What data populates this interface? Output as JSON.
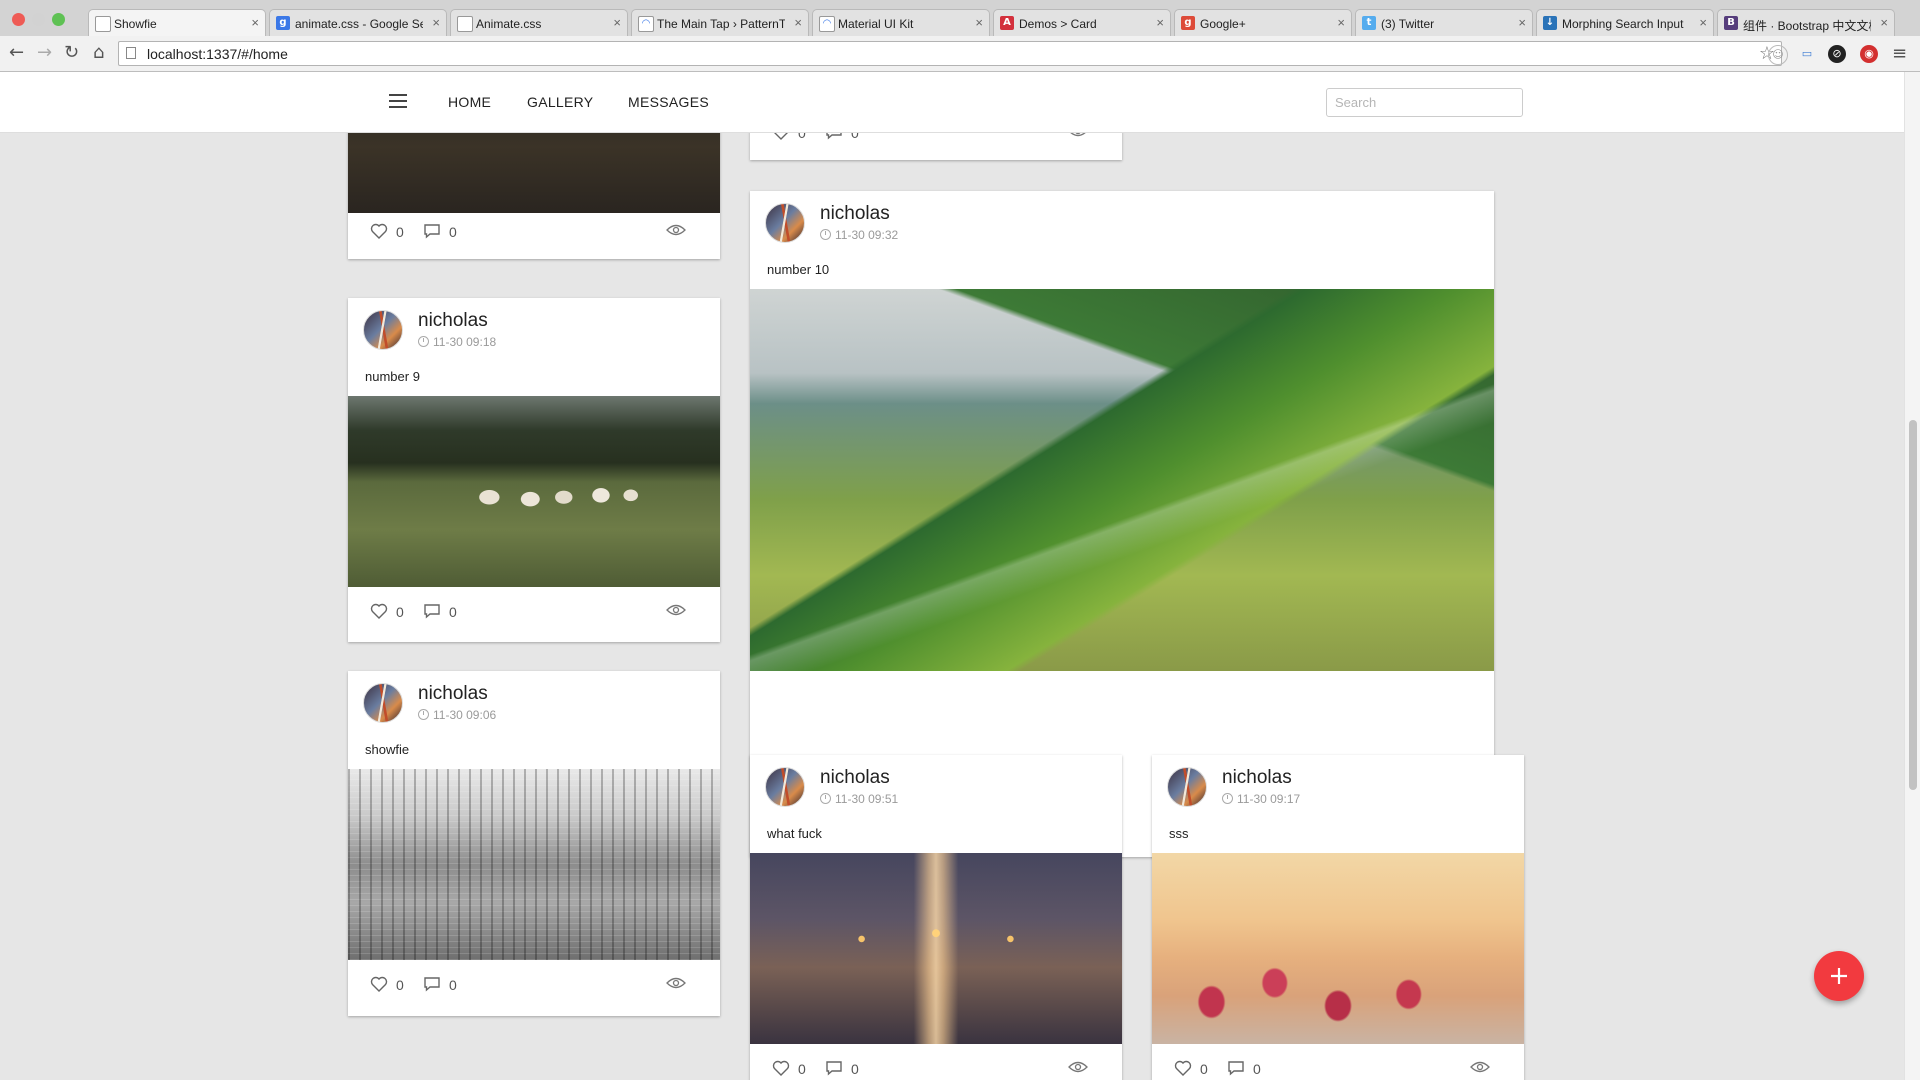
{
  "browser": {
    "tabs": [
      {
        "title": "Showfie",
        "active": true,
        "favicon_color": "#ffffff",
        "favicon_glyph": ""
      },
      {
        "title": "animate.css - Google Search",
        "active": false,
        "favicon_color": "#3b78e7",
        "favicon_glyph": "g"
      },
      {
        "title": "Animate.css",
        "active": false,
        "favicon_color": "#ffffff",
        "favicon_glyph": ""
      },
      {
        "title": "The Main Tap › PatternTap",
        "active": false,
        "favicon_color": "#ffffff",
        "favicon_glyph": "◠"
      },
      {
        "title": "Material UI Kit",
        "active": false,
        "favicon_color": "#ffffff",
        "favicon_glyph": "◠"
      },
      {
        "title": "Demos > Card",
        "active": false,
        "favicon_color": "#d3303c",
        "favicon_glyph": "A"
      },
      {
        "title": "Google+",
        "active": false,
        "favicon_color": "#dd4b39",
        "favicon_glyph": "g"
      },
      {
        "title": "(3) Twitter",
        "active": false,
        "favicon_color": "#55acee",
        "favicon_glyph": "t"
      },
      {
        "title": "Morphing Search Input",
        "active": false,
        "favicon_color": "#2a73b8",
        "favicon_glyph": "↓"
      },
      {
        "title": "组件 · Bootstrap 中文文档",
        "active": false,
        "favicon_color": "#563d7c",
        "favicon_glyph": "B"
      }
    ],
    "url": "localhost:1337/#/home",
    "tab_close_glyph": "×"
  },
  "nav": {
    "items": [
      "HOME",
      "GALLERY",
      "MESSAGES"
    ],
    "search_placeholder": "Search"
  },
  "posts": [
    {
      "id": "top-left",
      "user": "",
      "time": "",
      "caption": "",
      "likes": "0",
      "comments": "0",
      "image": "img-dark"
    },
    {
      "id": "top-right",
      "user": "",
      "time": "",
      "caption": "",
      "likes": "0",
      "comments": "0",
      "image": "img-dark"
    },
    {
      "id": "number9",
      "user": "nicholas",
      "time": "11-30 09:18",
      "caption": "number 9",
      "likes": "0",
      "comments": "0",
      "image": "img-sheep"
    },
    {
      "id": "number10",
      "user": "nicholas",
      "time": "11-30 09:32",
      "caption": "number 10",
      "likes": "0",
      "comments": "0",
      "image": "img-mountain"
    },
    {
      "id": "showfie",
      "user": "nicholas",
      "time": "11-30 09:06",
      "caption": "showfie",
      "likes": "0",
      "comments": "0",
      "image": "img-city"
    },
    {
      "id": "whatfuck",
      "user": "nicholas",
      "time": "11-30 09:51",
      "caption": "what fuck",
      "likes": "0",
      "comments": "0",
      "image": "img-road"
    },
    {
      "id": "sss",
      "user": "nicholas",
      "time": "11-30 09:17",
      "caption": "sss",
      "likes": "0",
      "comments": "0",
      "image": "img-berries"
    }
  ],
  "colors": {
    "fab": "#f23a3f",
    "background": "#e6e6e6"
  },
  "icons": {
    "menu": "hamburger-icon",
    "like": "heart-icon",
    "comment": "comment-icon",
    "views": "eye-icon",
    "add": "plus-icon",
    "back": "back-arrow-icon",
    "forward": "forward-arrow-icon",
    "reload": "reload-icon",
    "home": "home-icon",
    "bookmark": "star-icon"
  }
}
